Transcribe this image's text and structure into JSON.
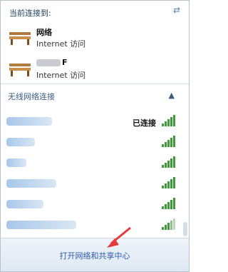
{
  "header": {
    "title": "当前连接到:"
  },
  "connected": [
    {
      "name": "网络",
      "status": "Internet 访问"
    },
    {
      "name": "F",
      "status": "Internet 访问"
    }
  ],
  "wireless": {
    "heading": "无线网络连接",
    "collapse_glyph": "▲",
    "rows": [
      {
        "status": "已连接"
      },
      {
        "status": ""
      },
      {
        "status": ""
      },
      {
        "status": ""
      },
      {
        "status": ""
      },
      {
        "status": ""
      }
    ]
  },
  "footer": {
    "link_label": "打开网络和共享中心"
  },
  "colors": {
    "signal": "#3f9a3a",
    "link": "#2a5dab",
    "arrow": "#e53a3a"
  },
  "icons": {
    "refresh": "refresh-icon",
    "network": "bench-network-icon",
    "signal": "signal-bars-icon"
  }
}
